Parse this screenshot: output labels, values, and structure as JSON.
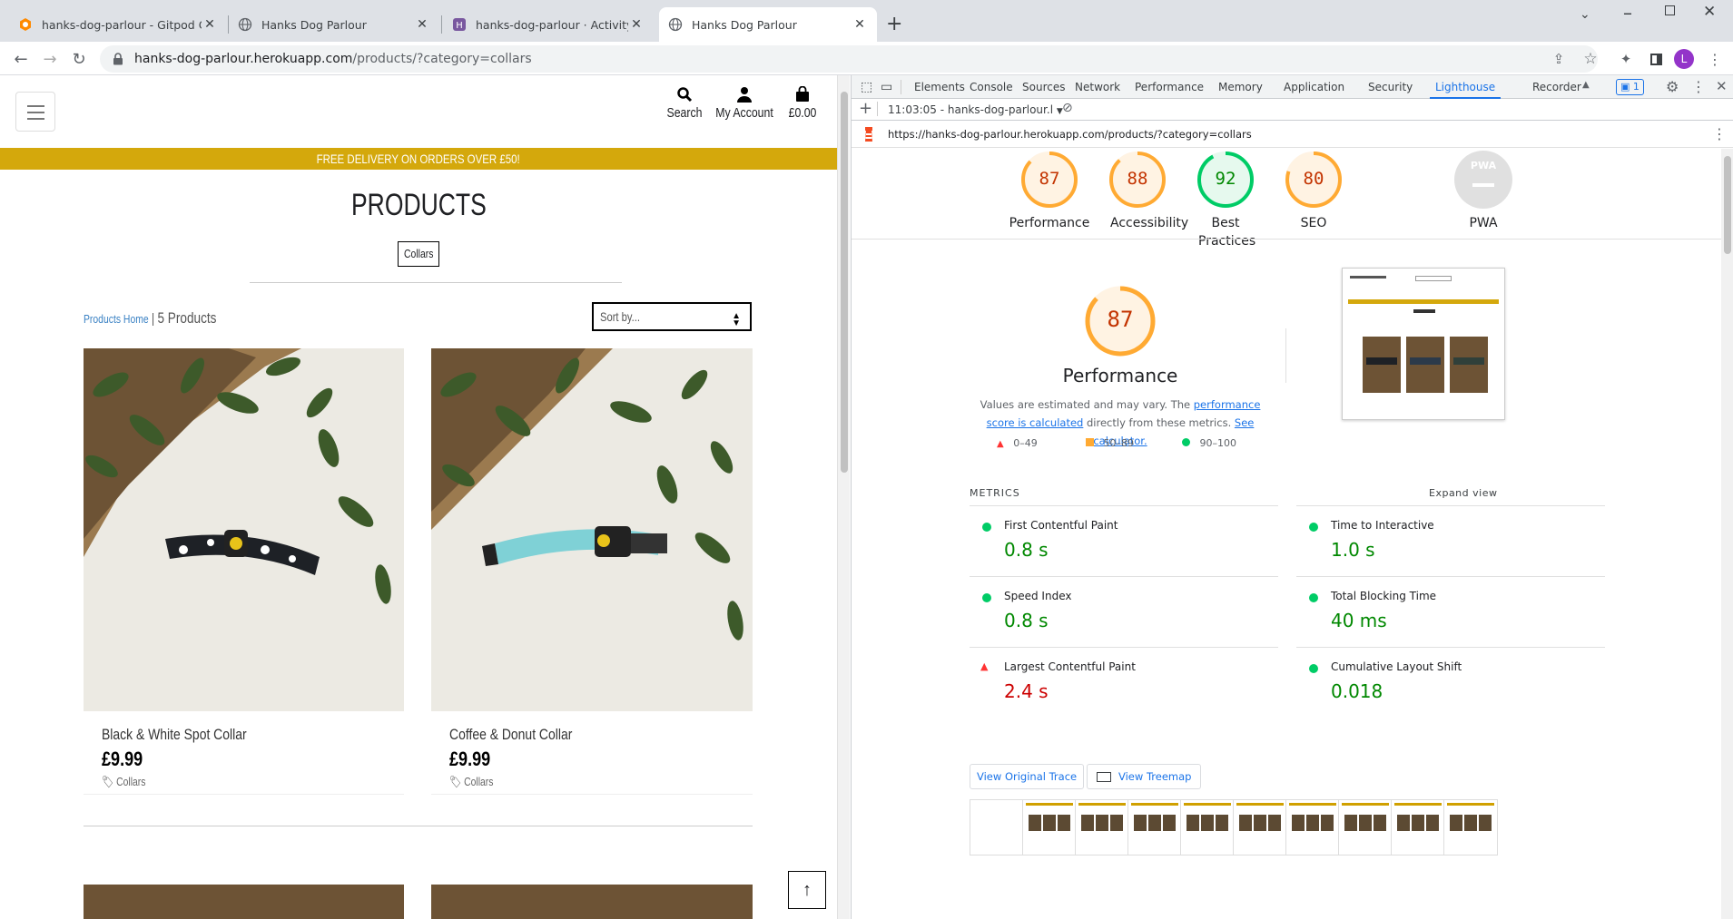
{
  "browser": {
    "tabs": [
      {
        "title": "hanks-dog-parlour - Gitpod Co",
        "icon": "gitpod-icon"
      },
      {
        "title": "Hanks Dog Parlour",
        "icon": "globe-icon"
      },
      {
        "title": "hanks-dog-parlour · Activity | He",
        "icon": "heroku-icon"
      },
      {
        "title": "Hanks Dog Parlour",
        "icon": "globe-icon",
        "active": true
      }
    ],
    "new_tab": "+",
    "url_host": "hanks-dog-parlour.herokuapp.com",
    "url_path": "/products/?category=collars",
    "profile_initial": "L"
  },
  "site": {
    "nav": {
      "search": "Search",
      "account": "My Account",
      "bag": "£0.00"
    },
    "banner": "FREE DELIVERY ON ORDERS OVER £50!",
    "title": "PRODUCTS",
    "category_badge": "Collars",
    "breadcrumb_home": "Products Home",
    "breadcrumb_sep": " | ",
    "product_count": "5 Products",
    "sort_placeholder": "Sort by...",
    "products": [
      {
        "name": "Black & White Spot Collar",
        "price": "£9.99",
        "category": "Collars"
      },
      {
        "name": "Coffee & Donut Collar",
        "price": "£9.99",
        "category": "Collars"
      }
    ]
  },
  "devtools": {
    "tabs": [
      "Elements",
      "Console",
      "Sources",
      "Network",
      "Performance",
      "Memory",
      "Application",
      "Security",
      "Lighthouse",
      "Recorder"
    ],
    "active_tab": "Lighthouse",
    "issues_count": "1",
    "report_time": "11:03:05 - hanks-dog-parlour.l",
    "report_url": "https://hanks-dog-parlour.herokuapp.com/products/?category=collars",
    "scores": [
      {
        "label": "Performance",
        "value": 87,
        "color": "#fa3"
      },
      {
        "label": "Accessibility",
        "value": 88,
        "color": "#fa3"
      },
      {
        "label": "Best Practices",
        "value": 92,
        "color": "#0c6"
      },
      {
        "label": "SEO",
        "value": 80,
        "color": "#fa3"
      }
    ],
    "pwa_label": "PWA",
    "pwa_badge": "PWA",
    "perf": {
      "score": 87,
      "title": "Performance",
      "desc_prefix": "Values are estimated and may vary. The ",
      "desc_link1": "performance score is calculated",
      "desc_mid": " directly from these metrics. ",
      "desc_link2": "See calculator.",
      "legend": [
        "0–49",
        "50–89",
        "90–100"
      ]
    },
    "metrics_heading": "METRICS",
    "expand_view": "Expand view",
    "metrics": [
      {
        "name": "First Contentful Paint",
        "value": "0.8 s",
        "status": "pass"
      },
      {
        "name": "Time to Interactive",
        "value": "1.0 s",
        "status": "pass"
      },
      {
        "name": "Speed Index",
        "value": "0.8 s",
        "status": "pass"
      },
      {
        "name": "Total Blocking Time",
        "value": "40 ms",
        "status": "pass"
      },
      {
        "name": "Largest Contentful Paint",
        "value": "2.4 s",
        "status": "fail"
      },
      {
        "name": "Cumulative Layout Shift",
        "value": "0.018",
        "status": "pass"
      }
    ],
    "view_trace": "View Original Trace",
    "view_treemap": "View Treemap",
    "colors": {
      "pass": "#0c6",
      "average": "#fa3",
      "fail": "#f33",
      "pass_text": "#080",
      "fail_text": "#c00"
    }
  }
}
